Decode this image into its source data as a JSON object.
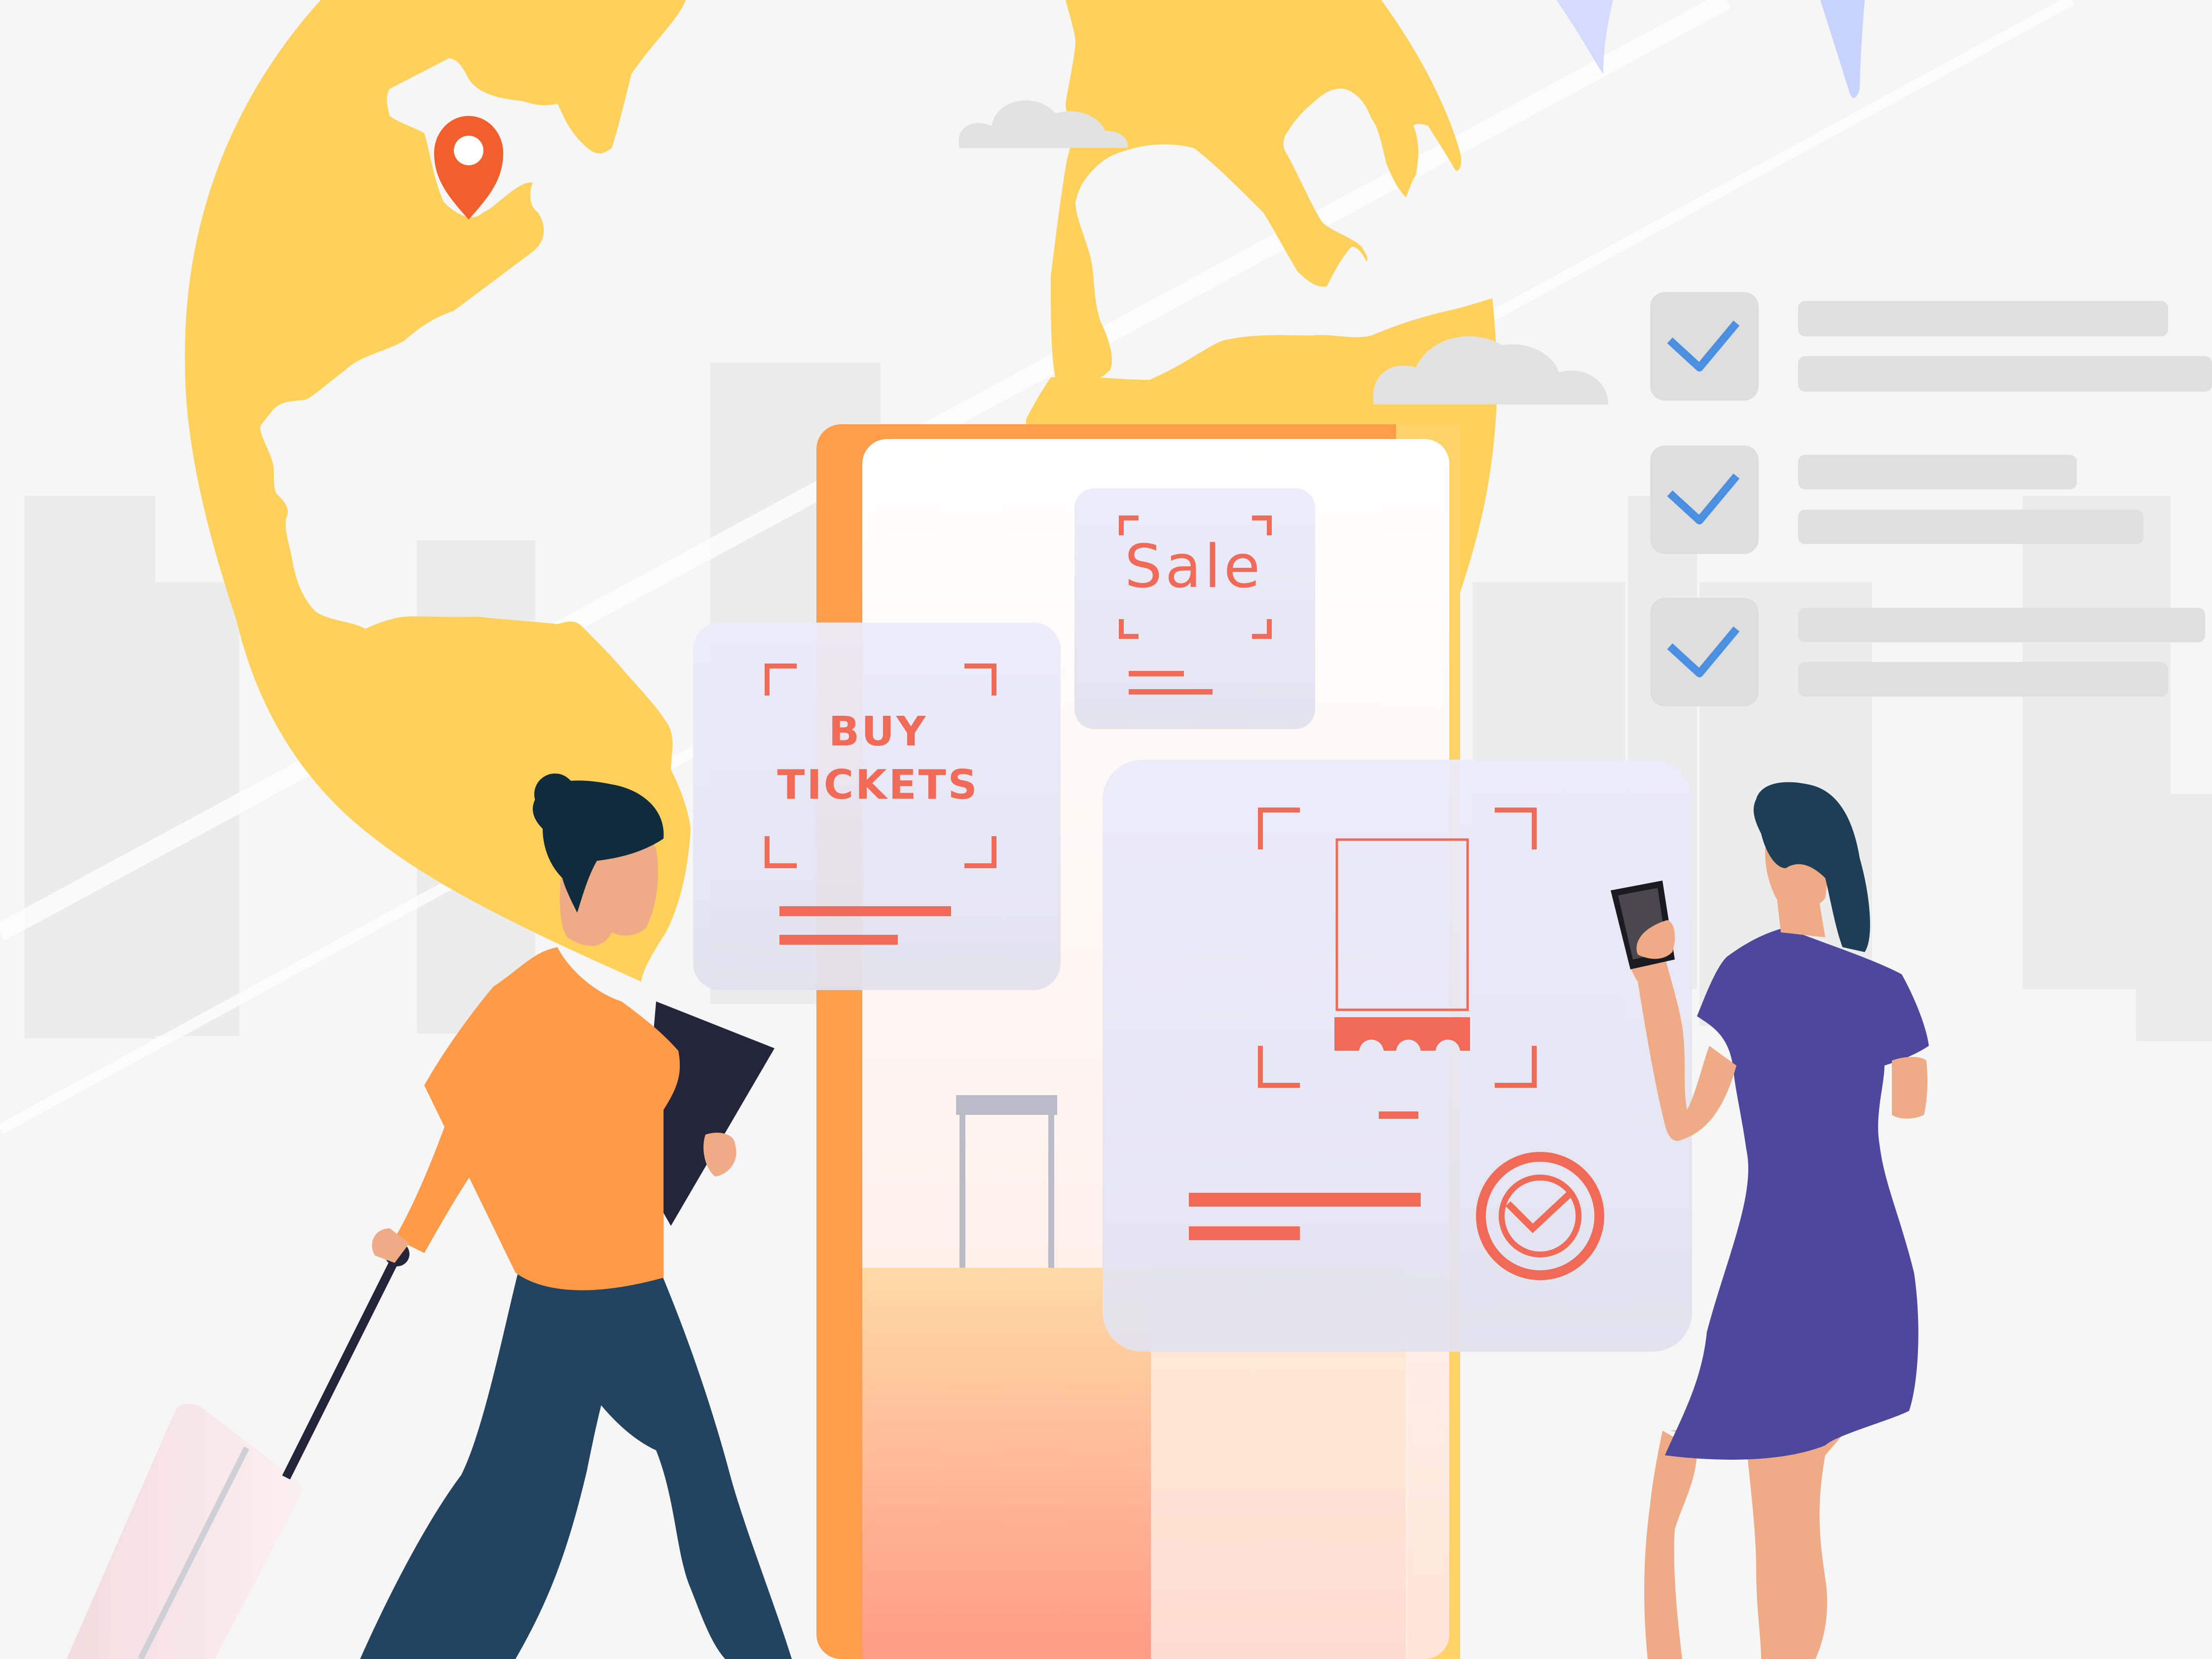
{
  "illustration": {
    "buy_card": {
      "line1": "BUY",
      "line2": "TICKETS"
    },
    "sale_card": {
      "label": "Sale"
    },
    "checklist": {
      "checked_items": 3
    },
    "colors": {
      "globe": "#ffd15a",
      "accent": "#f06a57",
      "orange": "#ff9a48",
      "navy": "#234460",
      "purple": "#4e479e",
      "skin": "#eeab86",
      "check_blue": "#4a8fe0"
    }
  }
}
